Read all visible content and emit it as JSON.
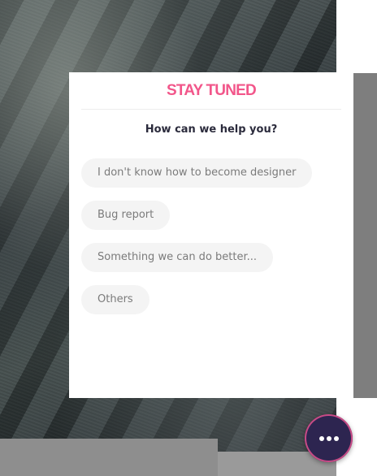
{
  "panel": {
    "title": "STAY TUNED",
    "question": "How can we help you?",
    "options": [
      {
        "label": "I don't know how to become designer"
      },
      {
        "label": "Bug report"
      },
      {
        "label": "Something we can do better..."
      },
      {
        "label": "Others"
      }
    ]
  },
  "fab": {
    "icon": "more-dots-icon"
  },
  "colors": {
    "title": "#f2568a",
    "question": "#2b2b3c",
    "option_text": "#7b7b7b",
    "option_bg": "#f4f4f4",
    "fab_bg": "#2d2550",
    "fab_ring": "#c74b86"
  }
}
